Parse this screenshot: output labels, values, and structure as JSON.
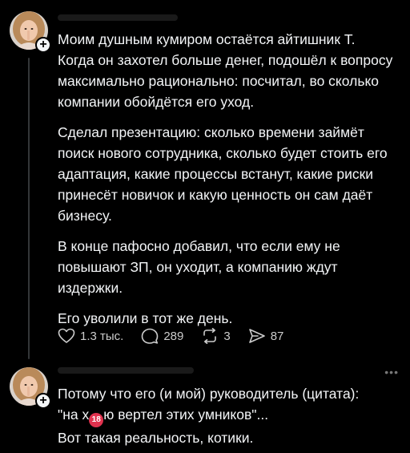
{
  "post_1": {
    "paragraphs": [
      "Моим душным кумиром остаётся айтишник Т. Когда он захотел больше денег, подошёл к вопросу максимально рационально: посчитал, во сколько компании обойдётся его уход.",
      "Сделал презентацию: сколько времени займёт поиск нового сотрудника, сколько будет стоить его адаптация, какие процессы встанут, какие риски принесёт новичок и какую ценность он сам даёт бизнесу.",
      "В конце пафосно добавил, что если ему не повышают ЗП, он уходит, а компанию ждут издержки.",
      "Его уволили в тот же день."
    ],
    "actions": {
      "likes": "1.3 тыс.",
      "comments": "289",
      "reposts": "3",
      "shares": "87"
    }
  },
  "post_2": {
    "line_1": "Потому что его (и мой) руководитель (цитата):",
    "line_2_before": "\"на х",
    "emoji_text": "18",
    "line_2_after": "ю вертел этих умников\"...",
    "line_3": "Вот такая реальность, котики."
  },
  "icons": {
    "follow": "plus-icon",
    "like": "heart-icon",
    "comment": "comment-icon",
    "repost": "repost-icon",
    "share": "share-icon",
    "more": "more-icon"
  },
  "colors": {
    "background": "#000000",
    "text": "#f3f5f7",
    "muted": "#cccccc",
    "thread_line": "#333638"
  }
}
